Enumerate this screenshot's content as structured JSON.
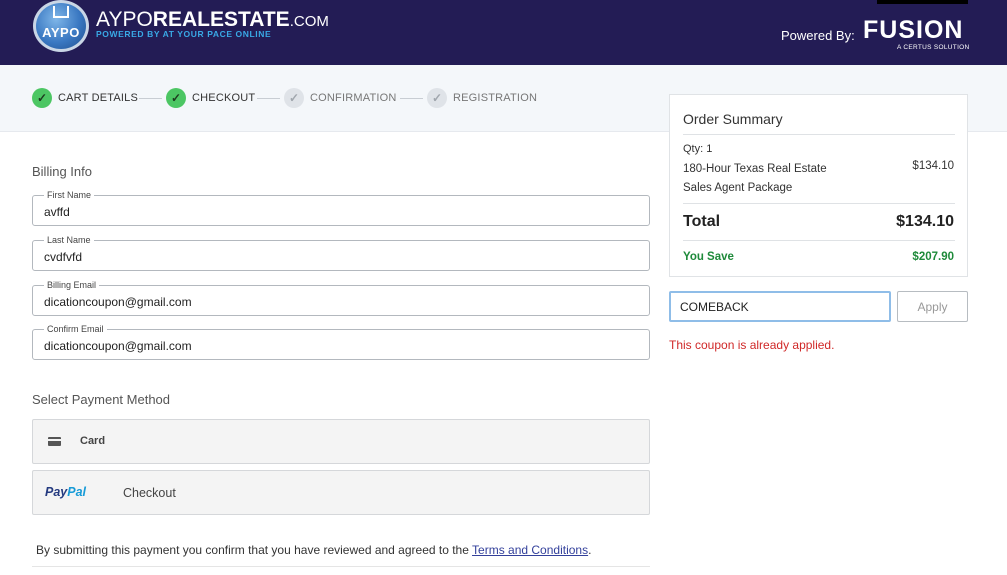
{
  "header": {
    "logo_badge_text": "AYPO",
    "brand_prefix": "AYPO",
    "brand_main": "REALESTATE",
    "brand_suffix": ".COM",
    "tagline": "POWERED BY AT YOUR PACE ONLINE",
    "powered_by": "Powered By:",
    "fusion": "FUSION",
    "certus": "A CERTUS SOLUTION"
  },
  "steps": [
    {
      "label": "CART DETAILS",
      "state": "done",
      "mark": "✓"
    },
    {
      "label": "CHECKOUT",
      "state": "done",
      "mark": "✓"
    },
    {
      "label": "CONFIRMATION",
      "state": "todo",
      "mark": "✓"
    },
    {
      "label": "REGISTRATION",
      "state": "todo",
      "mark": "✓"
    }
  ],
  "billing": {
    "title": "Billing Info",
    "fields": [
      {
        "label": "First Name",
        "value": "avffd"
      },
      {
        "label": "Last Name",
        "value": "cvdfvfd"
      },
      {
        "label": "Billing Email",
        "value": "dicationcoupon@gmail.com"
      },
      {
        "label": "Confirm Email",
        "value": "dicationcoupon@gmail.com"
      }
    ]
  },
  "payment": {
    "title": "Select Payment Method",
    "card_label": "Card",
    "paypal_pay": "Pay",
    "paypal_pal": "Pal",
    "paypal_checkout": "Checkout",
    "icons": [
      "credit-card-icon"
    ]
  },
  "terms": {
    "prefix": "By submitting this payment you confirm that you have reviewed and agreed to the ",
    "link": "Terms and Conditions",
    "suffix": "."
  },
  "summary": {
    "title": "Order Summary",
    "qty": "Qty: 1",
    "item_name": "180-Hour Texas Real Estate Sales Agent Package",
    "item_price": "$134.10",
    "total_label": "Total",
    "total_value": "$134.10",
    "save_label": "You Save",
    "save_value": "$207.90"
  },
  "coupon": {
    "value": "COMEBACK",
    "apply_label": "Apply",
    "message": "This coupon is already applied."
  },
  "colors": {
    "header_bg": "#231c55",
    "step_done": "#4cc663",
    "save_green": "#1e8a3a",
    "error_red": "#d02828"
  }
}
